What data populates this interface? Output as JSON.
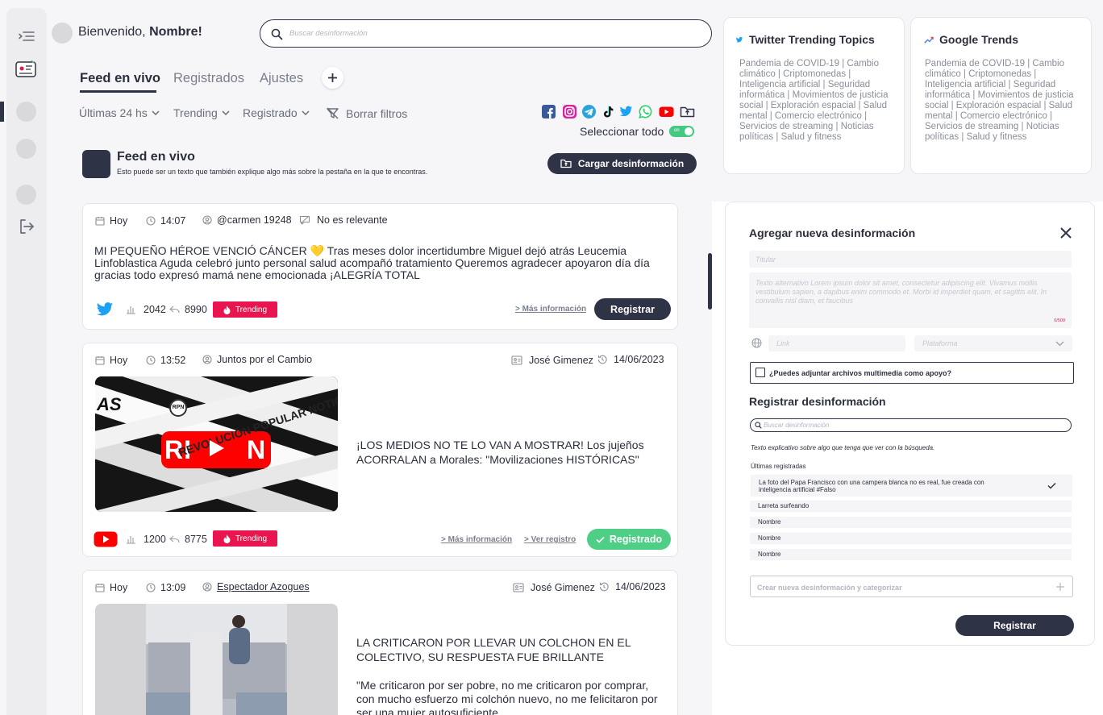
{
  "header": {
    "welcome_prefix": "Bienvenido,",
    "welcome_name": "Nombre!",
    "search_placeholder": "Buscar desinformación"
  },
  "tabs": [
    {
      "label": "Feed en vivo",
      "active": true
    },
    {
      "label": "Registrados",
      "active": false
    },
    {
      "label": "Ajustes",
      "active": false
    }
  ],
  "filters": {
    "time": "Últimas 24 hs",
    "trending": "Trending",
    "registered": "Registrado",
    "clear": "Borrar filtros"
  },
  "social_icons": [
    "facebook-icon",
    "instagram-icon",
    "telegram-icon",
    "tiktok-icon",
    "twitter-icon",
    "whatsapp-icon",
    "youtube-icon",
    "folder-upload-icon"
  ],
  "select_all": {
    "label": "Seleccionar todo",
    "toggle_text": "on",
    "checked": true
  },
  "feed_header": {
    "title": "Feed en vivo",
    "subtitle": "Esto puede ser un texto que también explique algo más sobre la pestaña en la que te encontras.",
    "upload_button": "Cargar desinformación"
  },
  "posts": [
    {
      "day": "Hoy",
      "time": "14:07",
      "author": "@carmen 19248",
      "relevance": "No es relevante",
      "text": "MI PEQUEÑO HÉROE VENCIÓ CÁNCER 💛 Tras meses dolor incertidumbre Miguel dejó atrás Leucemia Linfoblastica Aguda celebró junto personal salud acompañó tratamiento Queremos agradecer apoyaron día día gracias todo expresó mamá nene emocionada ¡ALEGRÍA TOTAL",
      "platform": "twitter-icon",
      "views": "2042",
      "shares": "8990",
      "badge": "Trending",
      "more_link": "> Más información",
      "button": "Registrar"
    },
    {
      "day": "Hoy",
      "time": "13:52",
      "author": "Juntos por el Cambio",
      "registered_by": "José Gimenez",
      "registered_date": "14/06/2023",
      "text": "¡LOS MEDIOS NO TE LO VAN A MOSTRAR! Los jujeños ACORRALAN a Morales: \"Movilizaciones HISTÓRICAS\"",
      "thumb_text_1": "REVOLUCIÓN POPULAR NOTICIAS",
      "thumb_text_2": "AS",
      "thumb_logo": "RPN",
      "platform": "youtube-icon",
      "views": "1200",
      "shares": "8775",
      "badge": "Trending",
      "more_link": "> Más información",
      "record_link": "> Ver registro",
      "button": "Registrado"
    },
    {
      "day": "Hoy",
      "time": "13:09",
      "author": "Espectador Azogues",
      "registered_by": "José Gimenez",
      "registered_date": "14/06/2023",
      "text_1": "LA CRITICARON POR LLEVAR UN COLCHON EN EL COLECTIVO, SU RESPUESTA FUE BRILLANTE",
      "text_2": "\"Me criticaron por ser pobre, no me criticaron por comprar, con mucho esfuerzo mi colchón nuevo, no me felicitaron por ser una mujer autosuficiente"
    }
  ],
  "twitter_trends": {
    "title": "Twitter Trending Topics",
    "body": "Pandemia de COVID-19 | Cambio climático | Criptomonedas | Inteligencia artificial | Seguridad informática | Movimientos de justicia social | Exploración espacial | Salud mental | Comercio electrónico | Servicios de streaming | Noticias políticas | Salud y fitness"
  },
  "google_trends": {
    "title": "Google Trends",
    "body": "Pandemia de COVID-19 | Cambio climático | Criptomonedas | Inteligencia artificial | Seguridad informática | Movimientos de justicia social | Exploración espacial | Salud mental | Comercio electrónico | Servicios de streaming | Noticias políticas | Salud y fitness"
  },
  "form": {
    "title": "Agregar nueva desinformación",
    "title_placeholder": "Titular",
    "description_placeholder": "Texto alternativo Lorem ipsum dolor sit amet, consectetur adipiscing elit. Vivamus mollis vestibulum sapien, a dapibus enim commodo et. Morbi id imperdiet quam, et sagittis elit. In convallis nisl diam, et faucibus",
    "char_count": "0/500",
    "link_placeholder": "Link",
    "platform_placeholder": "Plataforma",
    "attach_label": "¿Puedes adjuntar archivos multimedia como apoyo?",
    "register_title": "Registrar desinformación",
    "register_search_placeholder": "Buscar desinformación",
    "helper_text": "Texto explicativo sobre algo que tenga que ver con la búsqueda.",
    "recent_label": "Últimas registradas",
    "recent_items": [
      "La foto del Papa Francisco con una campera blanca no es real, fue creada con inteligencia artificial #Falso",
      "Larreta surfeando",
      "Nombre",
      "Nombre",
      "Nombre"
    ],
    "create_placeholder": "Crear nueva desinformación y categorizar",
    "submit": "Registrar"
  },
  "colors": {
    "dark": "#2f3346",
    "trending": "#e8154f",
    "registered": "#4fcf86",
    "toggle": "#43c980"
  }
}
